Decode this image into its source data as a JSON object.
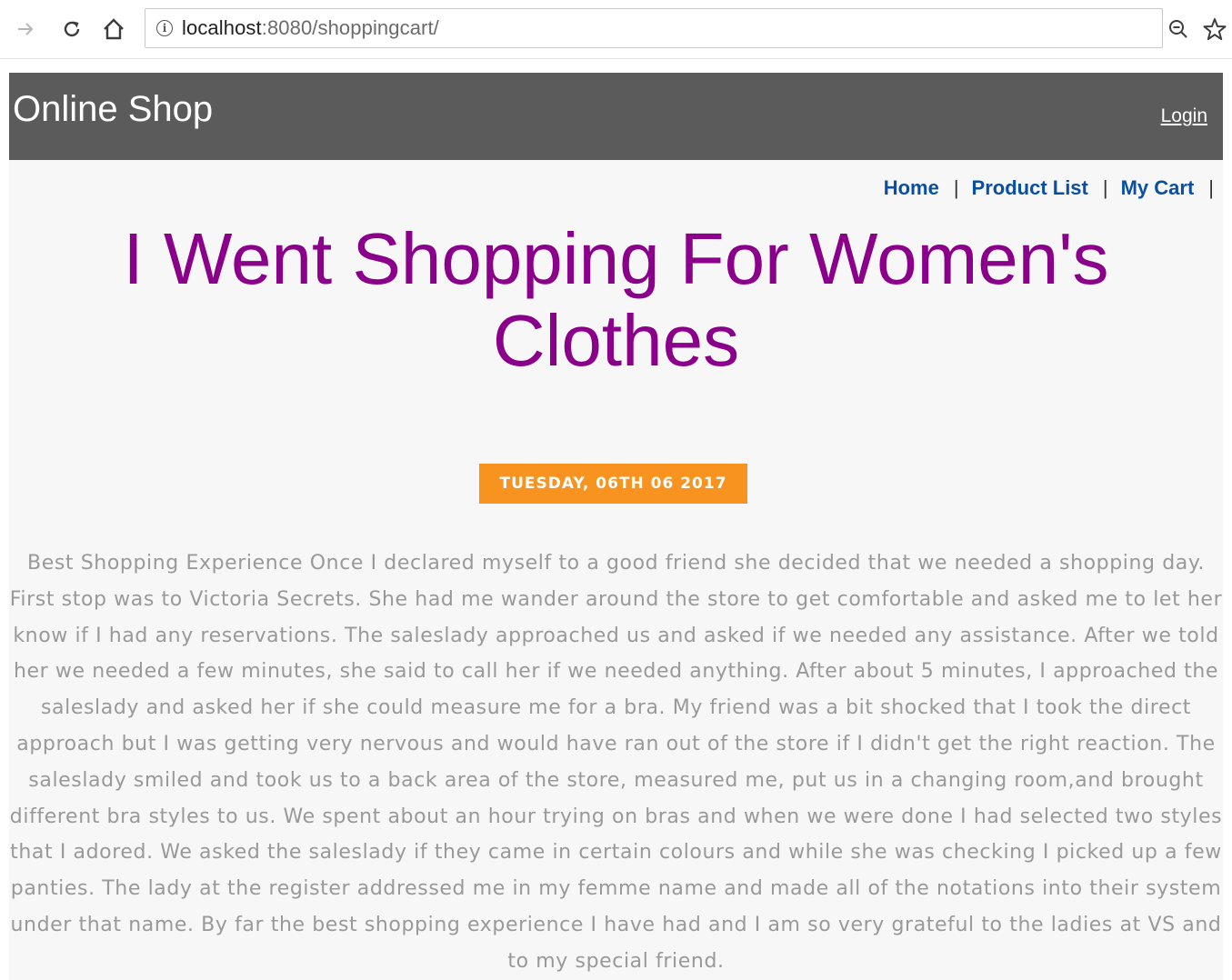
{
  "browser": {
    "url_host": "localhost",
    "url_path": ":8080/shoppingcart/"
  },
  "header": {
    "brand": "Online Shop",
    "login_label": "Login"
  },
  "nav": {
    "items": [
      {
        "label": "Home"
      },
      {
        "label": "Product List"
      },
      {
        "label": "My Cart"
      }
    ],
    "separator": "|"
  },
  "article": {
    "title": "I Went Shopping For Women's Clothes",
    "date": "TUESDAY, 06TH 06 2017",
    "body": "Best Shopping Experience Once I declared myself to a good friend she decided that we needed a shopping day. First stop was to Victoria Secrets. She had me wander around the store to get comfortable and asked me to let her know if I had any reservations. The saleslady approached us and asked if we needed any assistance. After we told her we needed a few minutes, she said to call her if we needed anything. After about 5 minutes, I approached the saleslady and asked her if she could measure me for a bra. My friend was a bit shocked that I took the direct approach but I was getting very nervous and would have ran out of the store if I didn't get the right reaction. The saleslady smiled and took us to a back area of the store, measured me, put us in a changing room,and brought different bra styles to us. We spent about an hour trying on bras and when we were done I had selected two styles that I adored. We asked the saleslady if they came in certain colours and while she was checking I picked up a few panties. The lady at the register addressed me in my femme name and made all of the notations into their system under that name. By far the best shopping experience I have had and I am so very grateful to the ladies at VS and to my special friend."
  },
  "colors": {
    "header_bg": "#5b5b5b",
    "title": "#8b008b",
    "date_badge": "#f7931e",
    "nav_link": "#0b4fa0",
    "body_text": "#999999"
  }
}
